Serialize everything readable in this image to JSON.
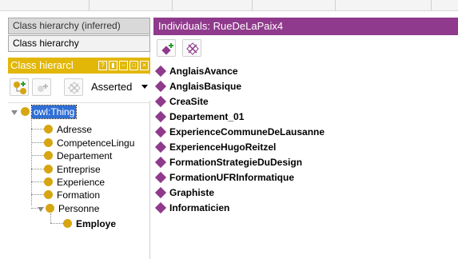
{
  "left_panel": {
    "tabs": {
      "inferred": "Class hierarchy (inferred)",
      "asserted": "Class hierarchy"
    },
    "view_title": "Class hierarcl",
    "header_buttons": [
      "?",
      "▮",
      "–",
      "□",
      "×"
    ],
    "mode_select": "Asserted",
    "tree": {
      "root": "owl:Thing",
      "children": [
        "Adresse",
        "CompetenceLingu",
        "Departement",
        "Entreprise",
        "Experience",
        "Formation",
        "Personne"
      ],
      "personne_children": [
        "Employe"
      ]
    }
  },
  "right_panel": {
    "title": "Individuals: RueDeLaPaix4",
    "individuals": [
      "AnglaisAvance",
      "AnglaisBasique",
      "CreaSite",
      "Departement_01",
      "ExperienceCommuneDeLausanne",
      "ExperienceHugoReitzel",
      "FormationStrategieDuDesign",
      "FormationUFRInformatique",
      "Graphiste",
      "Informaticien"
    ]
  },
  "colors": {
    "class_accent": "#e2b708",
    "class_dot": "#d6a512",
    "individual_accent": "#8f3a8c",
    "selection": "#2f6fd6"
  }
}
